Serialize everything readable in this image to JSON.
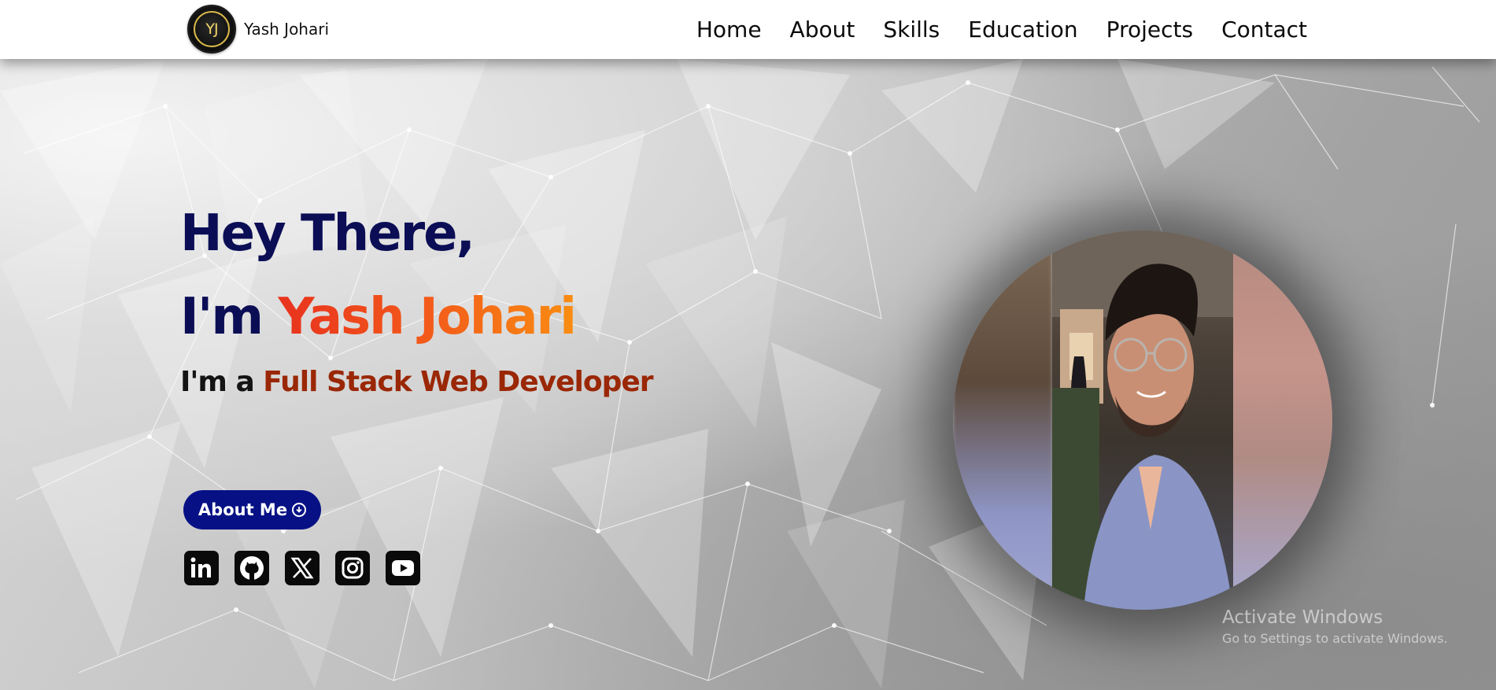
{
  "header": {
    "logo_text": "YJ",
    "brand_name": "Yash Johari",
    "nav": [
      {
        "label": "Home"
      },
      {
        "label": "About"
      },
      {
        "label": "Skills"
      },
      {
        "label": "Education"
      },
      {
        "label": "Projects"
      },
      {
        "label": "Contact"
      }
    ]
  },
  "hero": {
    "greeting": "Hey There,",
    "intro_prefix": "I'm ",
    "intro_name": "Yash Johari",
    "role_prefix": "I'm a ",
    "role_title": "Full Stack Web Developer",
    "about_button_label": "About Me",
    "socials": [
      {
        "icon": "linkedin-icon"
      },
      {
        "icon": "github-icon"
      },
      {
        "icon": "x-twitter-icon"
      },
      {
        "icon": "instagram-icon"
      },
      {
        "icon": "youtube-icon"
      }
    ],
    "portrait_icon": "profile-photo"
  },
  "watermark": {
    "title": "Activate Windows",
    "subtitle": "Go to Settings to activate Windows."
  },
  "colors": {
    "headline_navy": "#0b0e55",
    "name_gradient_start": "#e8321e",
    "name_gradient_end": "#f98d12",
    "role_accent": "#9a2705",
    "button_blue": "#071185"
  }
}
